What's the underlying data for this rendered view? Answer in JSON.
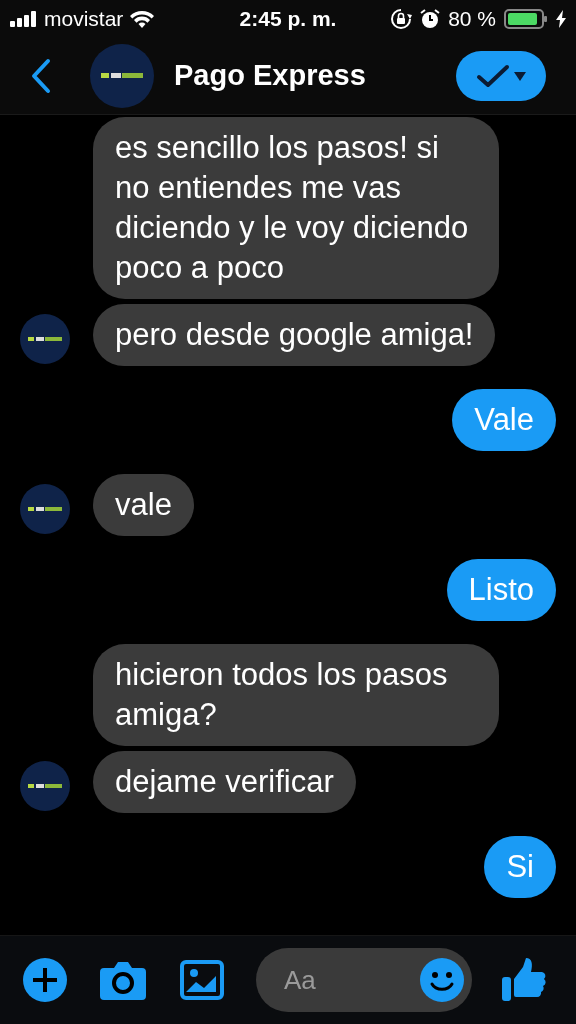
{
  "status_bar": {
    "carrier": "movistar",
    "time": "2:45 p. m.",
    "battery": "80 %"
  },
  "header": {
    "title": "Pago Express"
  },
  "messages": [
    {
      "outgoing": false,
      "text": "es sencillo los pasos! si no entiendes me vas diciendo y le voy diciendo poco a poco",
      "avatar": false
    },
    {
      "outgoing": false,
      "text": "pero desde google amiga!",
      "avatar": true
    },
    {
      "outgoing": true,
      "text": "Vale",
      "avatar": false
    },
    {
      "outgoing": false,
      "text": "vale",
      "avatar": true
    },
    {
      "outgoing": true,
      "text": "Listo",
      "avatar": false
    },
    {
      "outgoing": false,
      "text": "hicieron todos los pasos amiga?",
      "avatar": false
    },
    {
      "outgoing": false,
      "text": "dejame verificar",
      "avatar": true
    },
    {
      "outgoing": true,
      "text": "Si",
      "avatar": false
    }
  ],
  "composer": {
    "placeholder": "Aa"
  }
}
